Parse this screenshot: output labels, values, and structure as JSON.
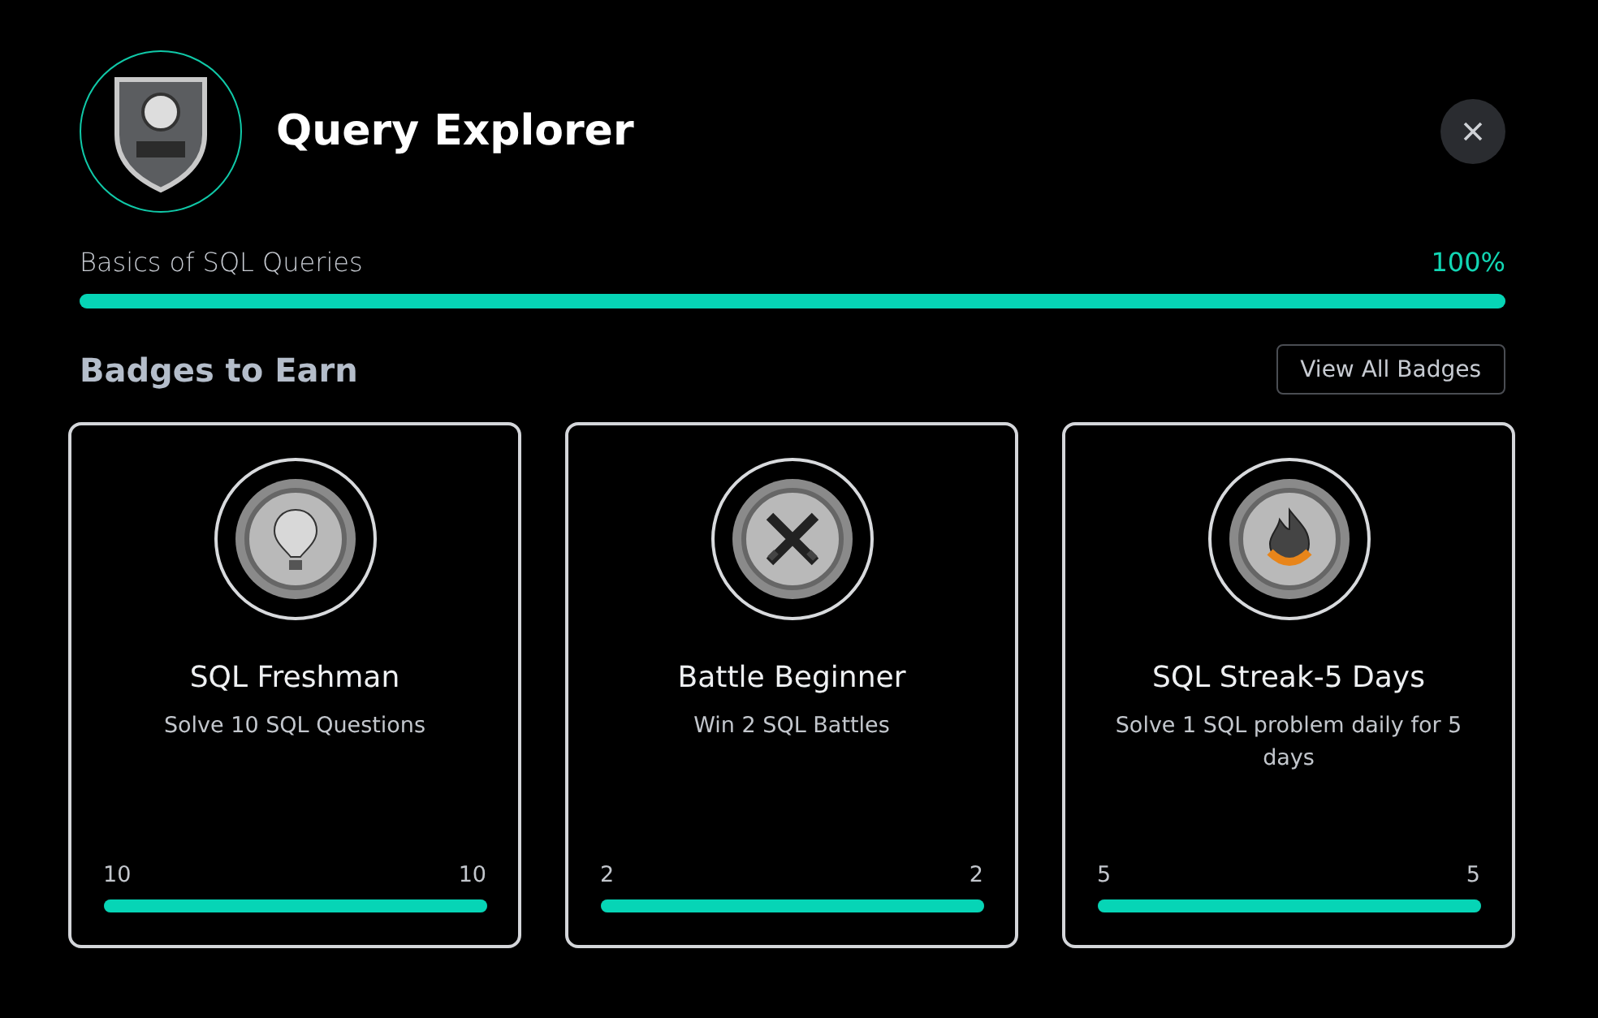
{
  "header": {
    "title": "Query Explorer"
  },
  "course": {
    "name": "Basics of SQL Queries",
    "percent": "100%",
    "level": 1
  },
  "badges_section": {
    "title": "Badges to Earn",
    "button": "View All Badges"
  },
  "badges": [
    {
      "kind": "balloon",
      "name": "SQL Freshman",
      "description": "Solve 10 SQL Questions",
      "current": "10",
      "target": "10",
      "level": 1
    },
    {
      "kind": "swords",
      "name": "Battle Beginner",
      "description": "Win 2 SQL Battles",
      "current": "2",
      "target": "2",
      "level": 1
    },
    {
      "kind": "flame",
      "name": "SQL Streak-5 Days",
      "description": "Solve 1 SQL problem daily for 5 days",
      "current": "5",
      "target": "5",
      "level": 1
    }
  ]
}
